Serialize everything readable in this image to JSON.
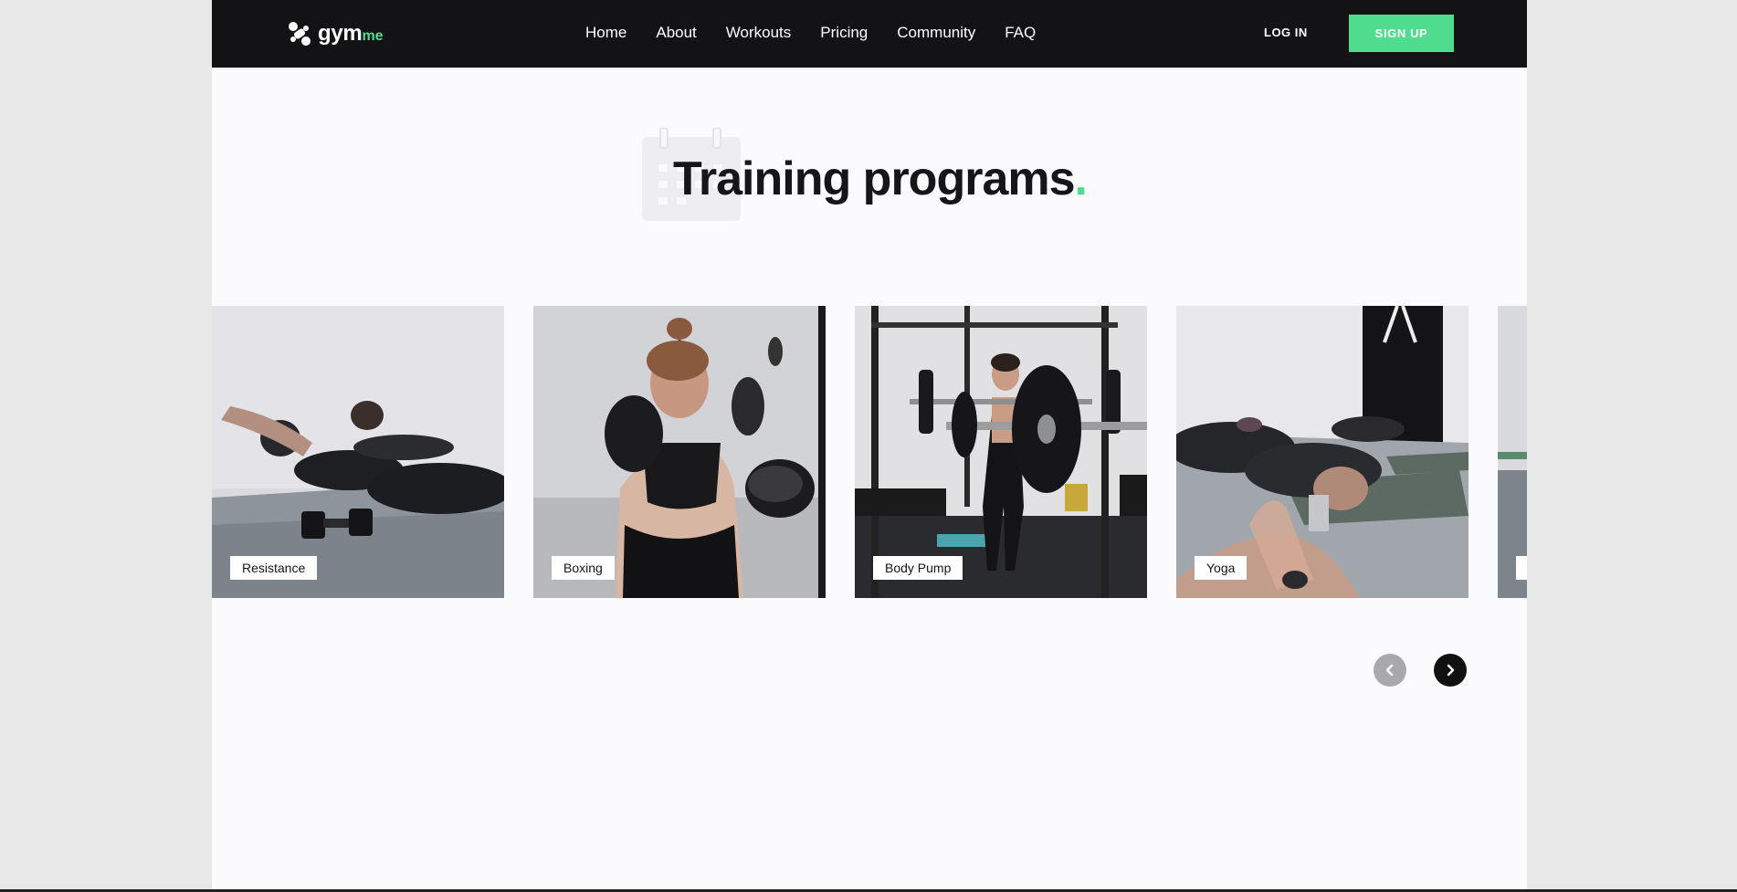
{
  "brand": {
    "name": "gym",
    "suffix": "me",
    "accent_color": "#4fdc8e",
    "nav_bg": "#131316"
  },
  "nav": {
    "links": [
      "Home",
      "About",
      "Workouts",
      "Pricing",
      "Community",
      "FAQ"
    ],
    "login_label": "LOG IN",
    "signup_label": "SIGN UP"
  },
  "section": {
    "title": "Training programs",
    "title_dot": ".",
    "icon": "calendar-icon"
  },
  "programs": [
    {
      "label": "Resistance"
    },
    {
      "label": "Boxing"
    },
    {
      "label": "Body Pump"
    },
    {
      "label": "Yoga"
    },
    {
      "label": ""
    }
  ],
  "carousel": {
    "prev_icon": "chevron-left-icon",
    "next_icon": "chevron-right-icon"
  }
}
